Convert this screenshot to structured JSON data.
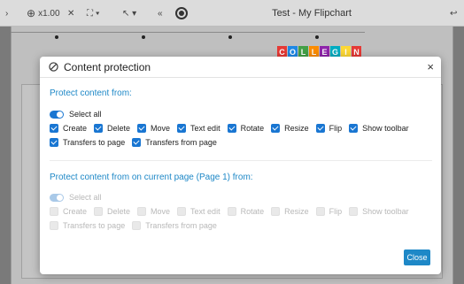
{
  "app": {
    "title": "Test - My Flipchart",
    "zoom": "x1.00",
    "logo_letters": [
      "C",
      "O",
      "L",
      "L",
      "E",
      "G",
      "I",
      "N"
    ],
    "logo_colors": [
      "#e53935",
      "#1e88e5",
      "#43a047",
      "#fb8c00",
      "#8e24aa",
      "#00acc1",
      "#fdd835",
      "#e53935"
    ]
  },
  "dialog": {
    "title": "Content protection",
    "section1": {
      "heading": "Protect content from:",
      "select_all": "Select all",
      "options_row1": [
        "Create",
        "Delete",
        "Move",
        "Text edit",
        "Rotate",
        "Resize",
        "Flip",
        "Show toolbar"
      ],
      "options_row2": [
        "Transfers to page",
        "Transfers from page"
      ]
    },
    "section2": {
      "heading": "Protect content from on current page (Page 1) from:",
      "select_all": "Select all",
      "options_row1": [
        "Create",
        "Delete",
        "Move",
        "Text edit",
        "Rotate",
        "Resize",
        "Flip",
        "Show toolbar"
      ],
      "options_row2": [
        "Transfers to page",
        "Transfers from page"
      ]
    },
    "close_label": "Close"
  }
}
